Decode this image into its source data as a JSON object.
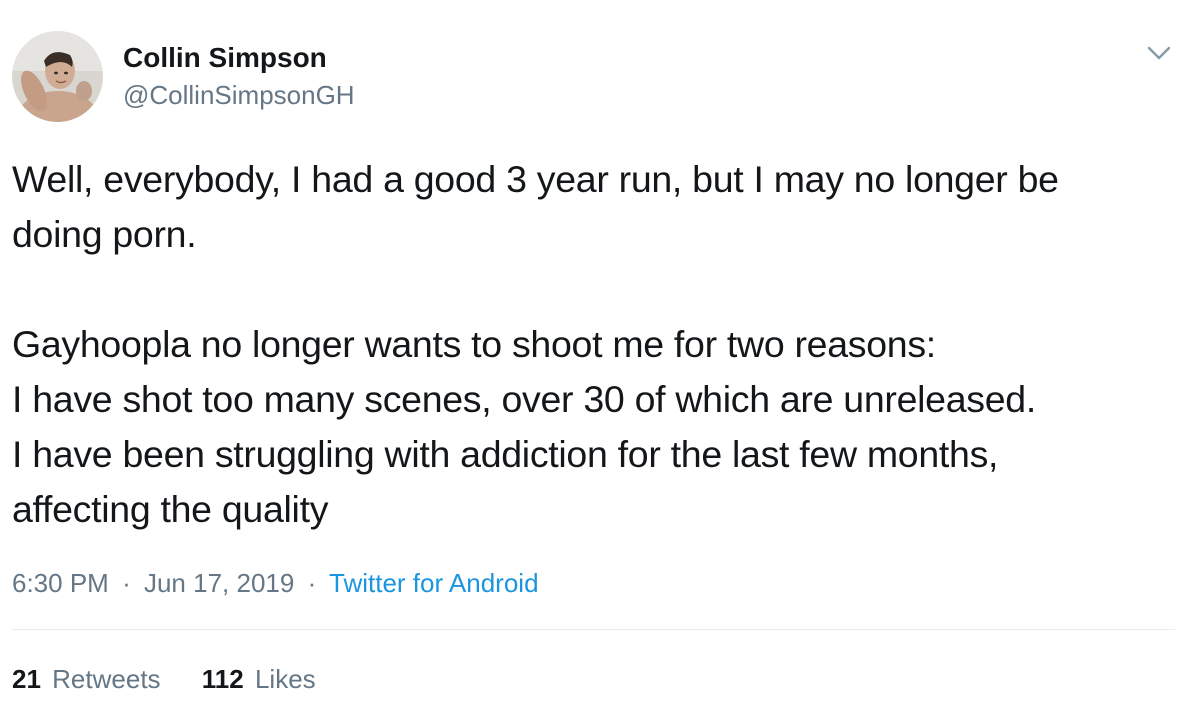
{
  "author": {
    "name": "Collin Simpson",
    "handle": "@CollinSimpsonGH"
  },
  "tweet": {
    "lines": [
      "Well, everybody, I had a good 3 year run, but I may no longer be",
      "doing porn.",
      "Gayhoopla no longer wants to shoot me for two reasons:",
      "I have shot too many scenes, over 30 of which are unreleased.",
      "I have been struggling with addiction for the last few months,",
      "affecting the quality"
    ],
    "time": "6:30 PM",
    "date": "Jun 17, 2019",
    "source": "Twitter for Android",
    "separator": "·"
  },
  "stats": {
    "retweets_count": "21",
    "retweets_label": "Retweets",
    "likes_count": "112",
    "likes_label": "Likes"
  },
  "icons": {
    "menu": "chevron-down-icon",
    "avatar": "profile-photo"
  },
  "colors": {
    "text": "#14171a",
    "secondary": "#657786",
    "link": "#1b95e0",
    "divider": "#e6ecf0"
  }
}
